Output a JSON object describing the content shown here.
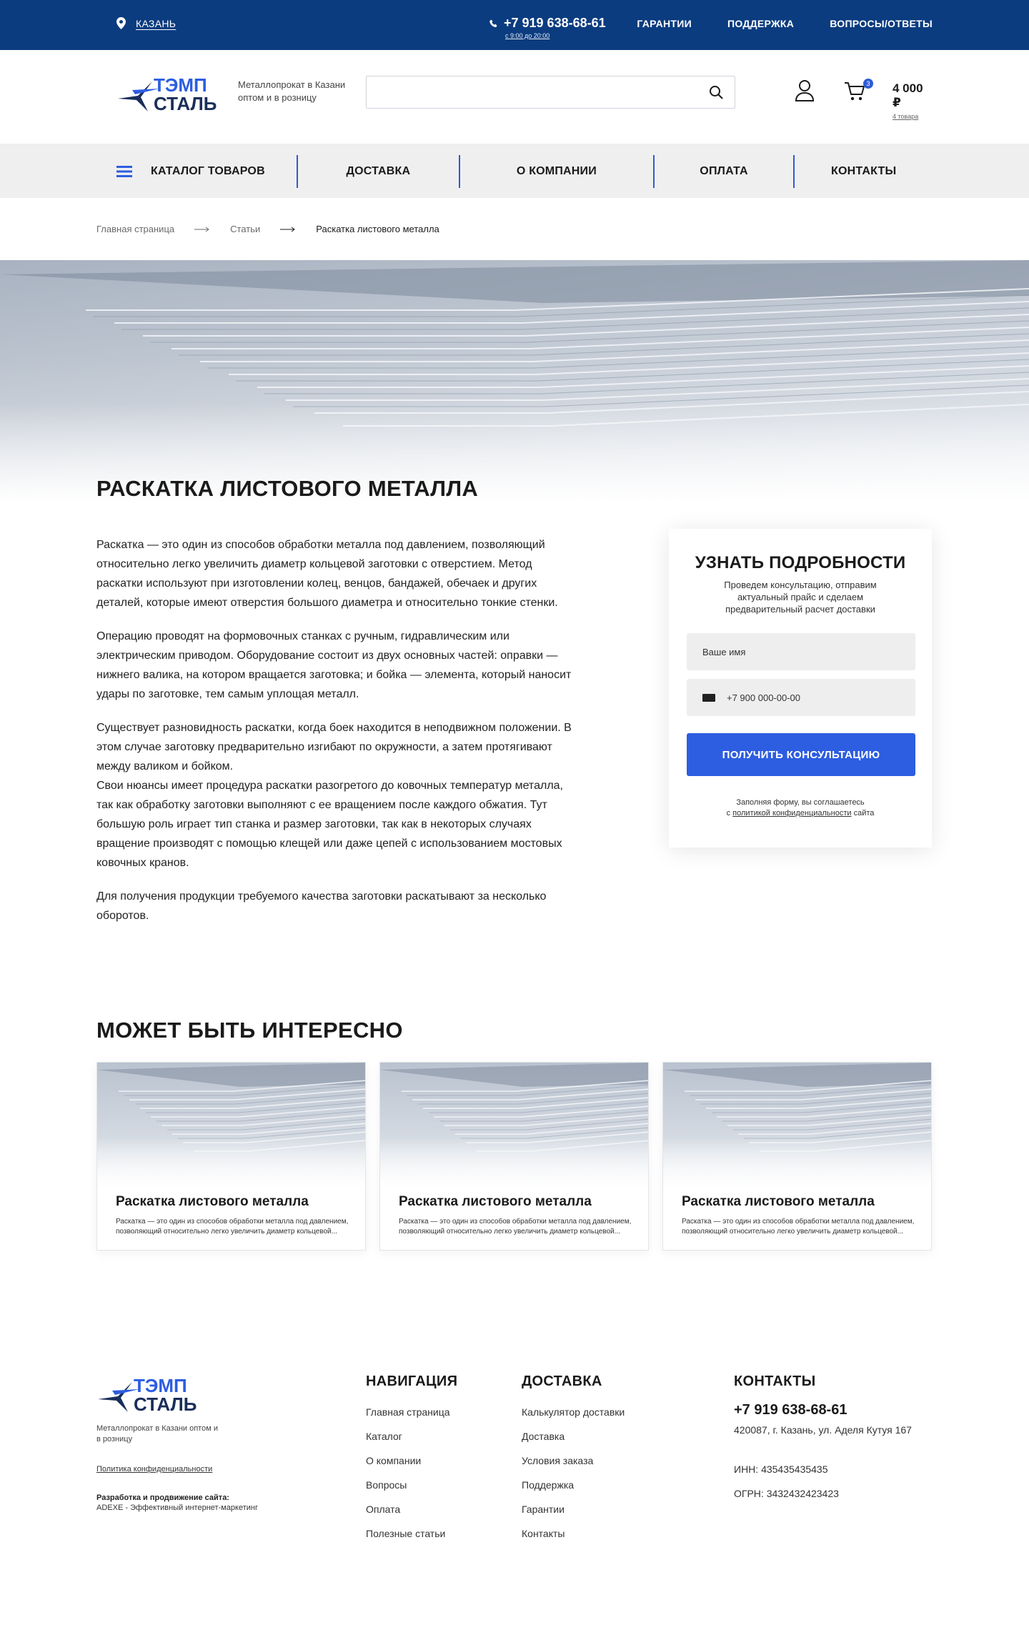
{
  "topbar": {
    "city": "КАЗАНЬ",
    "phone": "+7 919 638-68-61",
    "hours": "с 9:00 до 20:00",
    "links": [
      "ГАРАНТИИ",
      "ПОДДЕРЖКА",
      "ВОПРОСЫ/ОТВЕТЫ"
    ]
  },
  "header": {
    "logo_line1": "ТЭМП",
    "logo_line2": "СТАЛЬ",
    "slogan": "Металлопрокат в Казани оптом и в розницу",
    "search_placeholder": "",
    "cart_count": "3",
    "cart_sum": "4 000 ₽",
    "cart_items": "4 товара"
  },
  "nav": {
    "catalog": "КАТАЛОГ ТОВАРОВ",
    "items": [
      "ДОСТАВКА",
      "О КОМПАНИИ",
      "ОПЛАТА",
      "КОНТАКТЫ"
    ]
  },
  "breadcrumb": [
    "Главная страница",
    "Статьи",
    "Раскатка листового металла"
  ],
  "page_title": "РАСКАТКА ЛИСТОВОГО МЕТАЛЛА",
  "article": [
    "Раскатка — это один из способов обработки металла под давлением, позволяющий относительно легко увеличить диаметр кольцевой заготовки с отверстием. Метод раскатки используют при изготовлении колец, венцов, бандажей, обечаек и других деталей, которые имеют отверстия большого диаметра и относительно тонкие стенки.",
    "Операцию проводят на формовочных станках с ручным, гидравлическим или электрическим приводом. Оборудование состоит из двух основных частей: оправки — нижнего валика, на котором вращается заготовка; и бойка — элемента, который наносит удары по заготовке, тем самым уплощая металл.",
    "Существует разновидность раскатки, когда боек находится в неподвижном положении. В этом случае заготовку предварительно изгибают по окружности, а затем протягивают между валиком и бойком.",
    "Свои нюансы имеет процедура раскатки разогретого до ковочных температур металла, так как обработку заготовки выполняют с ее вращением после каждого обжатия. Тут большую роль играет тип станка и размер заготовки, так как в некоторых случаях вращение производят с помощью клещей или даже цепей с использованием мостовых ковочных кранов.",
    "Для получения продукции требуемого качества заготовки раскатывают за несколько оборотов."
  ],
  "form": {
    "title": "УЗНАТЬ ПОДРОБНОСТИ",
    "subtitle": "Проведем консультацию, отправим актуальный прайс и сделаем предварительный расчет доставки",
    "name_placeholder": "Ваше имя",
    "phone_placeholder": "+7 900 000-00-00",
    "button": "ПОЛУЧИТЬ КОНСУЛЬТАЦИЮ",
    "note_pre": "Заполняя форму, вы соглашаетесь",
    "note_pre2": "с ",
    "note_link": "политикой конфиденциальности",
    "note_post": " сайта"
  },
  "related": {
    "title": "МОЖЕТ БЫТЬ ИНТЕРЕСНО",
    "cards": [
      {
        "title": "Раскатка листового металла",
        "desc": "Раскатка — это один из способов обработки металла под давлением, позволяющий относительно легко увеличить диаметр кольцевой..."
      },
      {
        "title": "Раскатка листового металла",
        "desc": "Раскатка — это один из способов обработки металла под давлением, позволяющий относительно легко увеличить диаметр кольцевой..."
      },
      {
        "title": "Раскатка листового металла",
        "desc": "Раскатка — это один из способов обработки металла под давлением, позволяющий относительно легко увеличить диаметр кольцевой..."
      }
    ]
  },
  "footer": {
    "slogan": "Металлопрокат в Казани оптом и в розницу",
    "policy": "Политика конфиденциальности",
    "dev_title": "Разработка и продвижение сайта:",
    "dev": "ADEXE - Эффективный интернет-маркетинг",
    "nav_title": "НАВИГАЦИЯ",
    "nav": [
      "Главная страница",
      "Каталог",
      "О компании",
      "Вопросы",
      "Оплата",
      "Полезные статьи"
    ],
    "delivery_title": "ДОСТАВКА",
    "delivery": [
      "Калькулятор доставки",
      "Доставка",
      "Условия заказа",
      "Поддержка",
      "Гарантии",
      "Контакты"
    ],
    "contacts_title": "КОНТАКТЫ",
    "phone": "+7 919 638-68-61",
    "address": "420087,  г. Казань, ул. Аделя Кутуя 167",
    "inn": "ИНН: 435435435435",
    "ogrn": "ОГРН: 3432432423423"
  },
  "colors": {
    "topbar_bg": "#0b3c7f",
    "accent": "#2d5de0",
    "nav_bg": "#efefef"
  },
  "icons": [
    "location-pin-icon",
    "phone-icon",
    "search-icon",
    "user-icon",
    "cart-icon",
    "hamburger-icon",
    "arrow-right-icon"
  ]
}
